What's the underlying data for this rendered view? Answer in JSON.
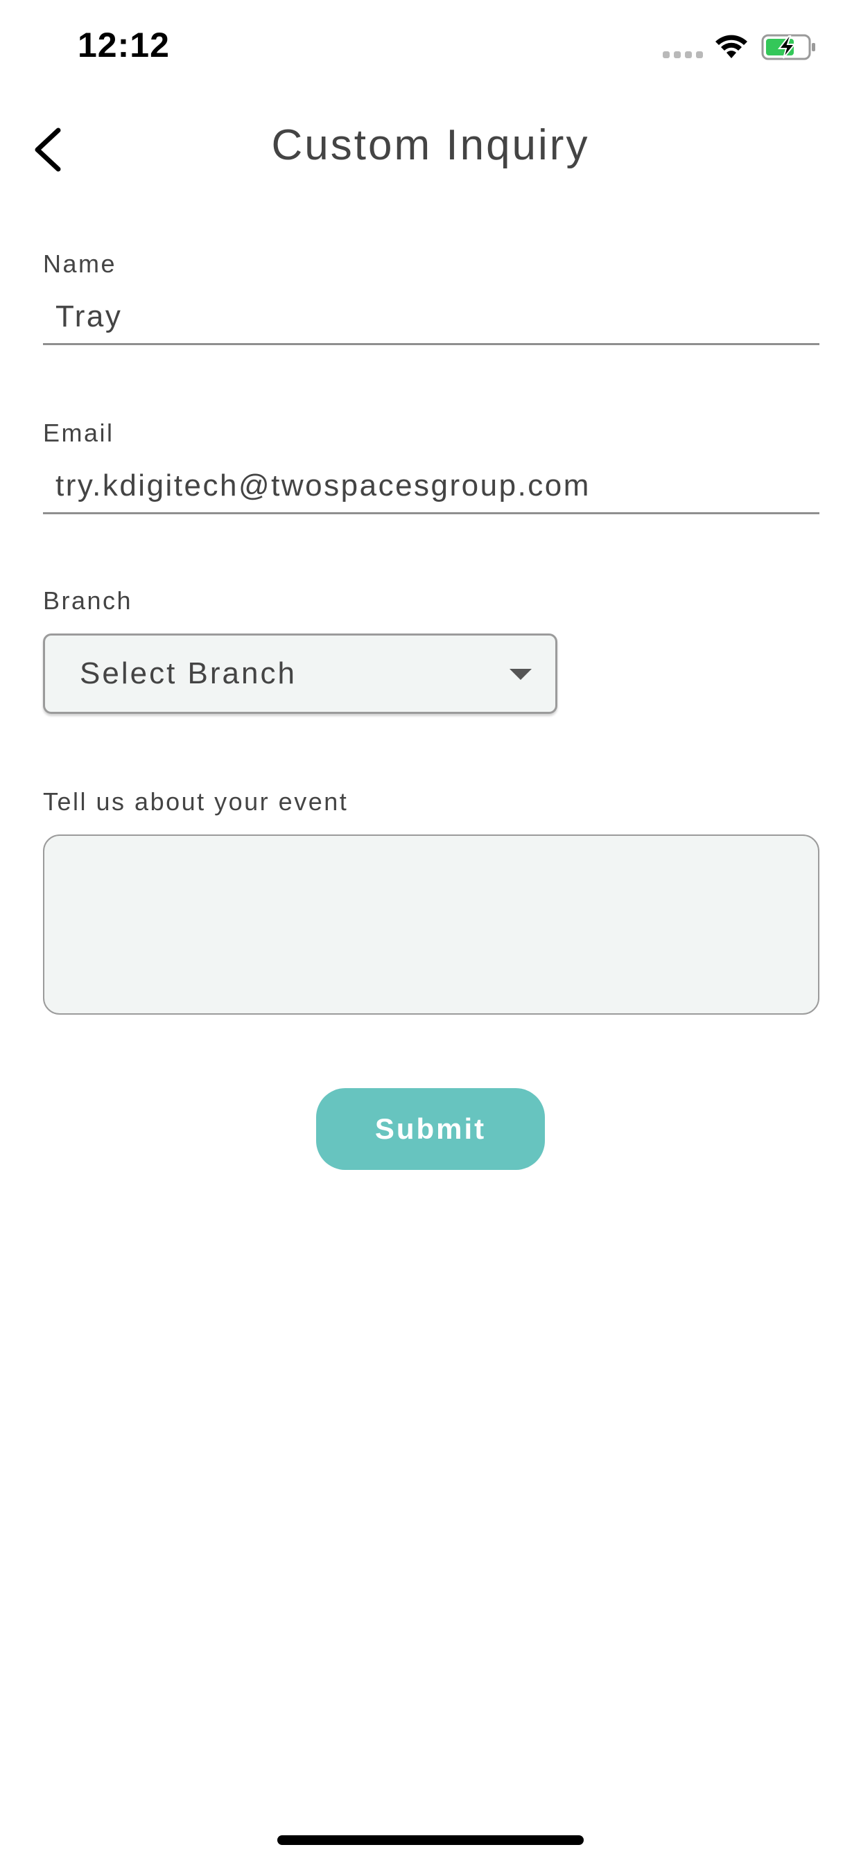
{
  "status_bar": {
    "time": "12:12",
    "wifi_icon": "wifi-icon",
    "battery_icon": "battery-charging-icon",
    "battery_color": "#34c759"
  },
  "header": {
    "title": "Custom Inquiry",
    "back_icon": "chevron-left-icon"
  },
  "form": {
    "name": {
      "label": "Name",
      "value": "Tray"
    },
    "email": {
      "label": "Email",
      "value": "try.kdigitech@twospacesgroup.com"
    },
    "branch": {
      "label": "Branch",
      "selected": "Select Branch"
    },
    "event": {
      "label": "Tell us about your event",
      "value": ""
    },
    "submit_label": "Submit"
  },
  "colors": {
    "accent": "#67c4bf",
    "field_background": "#f2f5f4",
    "text": "#444444"
  }
}
